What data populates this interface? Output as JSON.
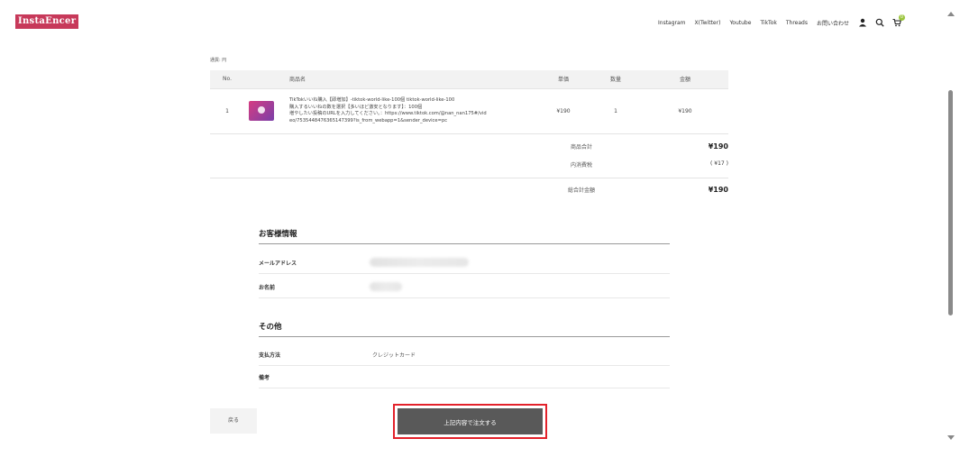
{
  "header": {
    "logo": "InstaEncer",
    "nav": [
      "Instagram",
      "X(Twitter)",
      "Youtube",
      "TikTok",
      "Threads",
      "お問い合わせ"
    ],
    "cart_count": "0",
    "icons": [
      "user-icon",
      "search-icon",
      "cart-icon"
    ]
  },
  "currency_label": "通貨: 円",
  "table": {
    "headers": {
      "no": "No.",
      "name": "商品名",
      "unit_price": "単価",
      "qty": "数量",
      "amount": "金額"
    },
    "rows": [
      {
        "no": "1",
        "name_lines": [
          "TikTokいいね購入【即増加】-tiktok-world-like-100個 tiktok-world-like-100",
          "購入するいいねの数を選択【多いほど激安となります】：100個",
          "増やしたい投稿のURLを入力してください。：https://www.tiktok.com/@nan_nan175#/vid",
          "eo/7535448476365147399?is_from_webapp=1&sender_device=pc"
        ],
        "unit_price": "¥190",
        "qty": "1",
        "amount": "¥190"
      }
    ]
  },
  "summary": {
    "subtotal_label": "商品合計",
    "subtotal": "¥190",
    "tax_label": "内消費税",
    "tax": "( ¥17 )",
    "total_label": "総合計金額",
    "total": "¥190"
  },
  "customer": {
    "title": "お客様情報",
    "email_label": "メールアドレス",
    "name_label": "お名前"
  },
  "other": {
    "title": "その他",
    "payment_label": "支払方法",
    "payment_value": "クレジットカード",
    "note_label": "備考"
  },
  "buttons": {
    "back": "戻る",
    "order": "上記内容で注文する"
  },
  "colors": {
    "logo_bg": "#c7395a",
    "order_btn": "#595959",
    "highlight": "#e3222b",
    "badge": "#9bc53d"
  }
}
